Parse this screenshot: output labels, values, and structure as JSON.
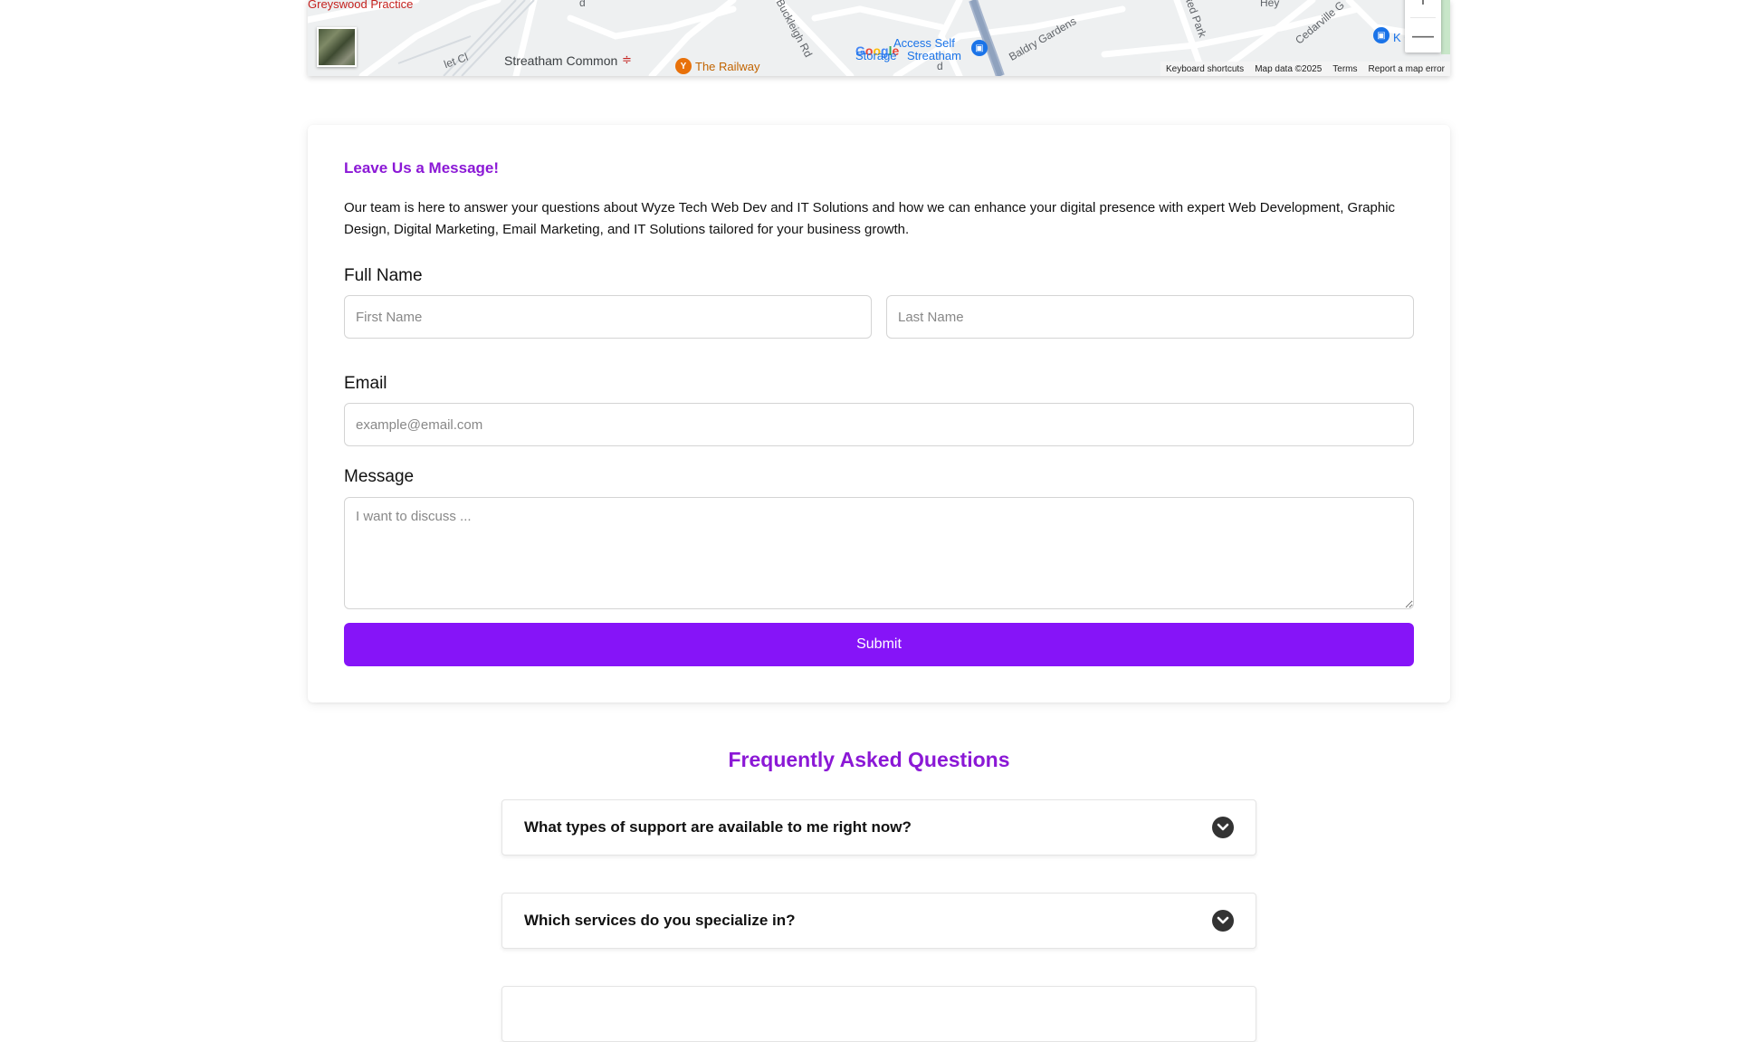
{
  "map": {
    "labels": {
      "greyswood": "Greyswood Practice",
      "streatham_common": "Streatham Common",
      "the_railway": "The Railway",
      "buckleigh": "Buckleigh Rd",
      "access_self_storage_1": "Access Self",
      "access_self_storage_2": "Streatham",
      "storage_word": "Storage",
      "baldry": "Baldry Gardens",
      "cedarville": "Cedarville G",
      "ested_park": "xted Park",
      "hey": "Hey",
      "ka": "K Ca",
      "let_cl": "let Cl",
      "rd_top": "d",
      "rd_bottom": "d"
    },
    "google_logo": [
      "G",
      "o",
      "o",
      "g",
      "l",
      "e"
    ],
    "footer": {
      "shortcuts": "Keyboard shortcuts",
      "data": "Map data ©2025",
      "terms": "Terms",
      "report": "Report a map error"
    },
    "zoom_in": "+",
    "zoom_out": "—"
  },
  "contact": {
    "title": "Leave Us a Message!",
    "intro": "Our team is here to answer your questions about Wyze Tech Web Dev and IT Solutions and how we can enhance your digital presence with expert Web Development, Graphic Design, Digital Marketing, Email Marketing, and IT Solutions tailored for your business growth.",
    "full_name_label": "Full Name",
    "first_name_placeholder": "First Name",
    "last_name_placeholder": "Last Name",
    "email_label": "Email",
    "email_placeholder": "example@email.com",
    "message_label": "Message",
    "message_placeholder": "I want to discuss ...",
    "submit_label": "Submit"
  },
  "faq": {
    "title": "Frequently Asked Questions",
    "items": [
      {
        "question": "What types of support are available to me right now?"
      },
      {
        "question": "Which services do you specialize in?"
      }
    ]
  },
  "colors": {
    "accent": "#8b18d6",
    "button": "#8614f8"
  }
}
